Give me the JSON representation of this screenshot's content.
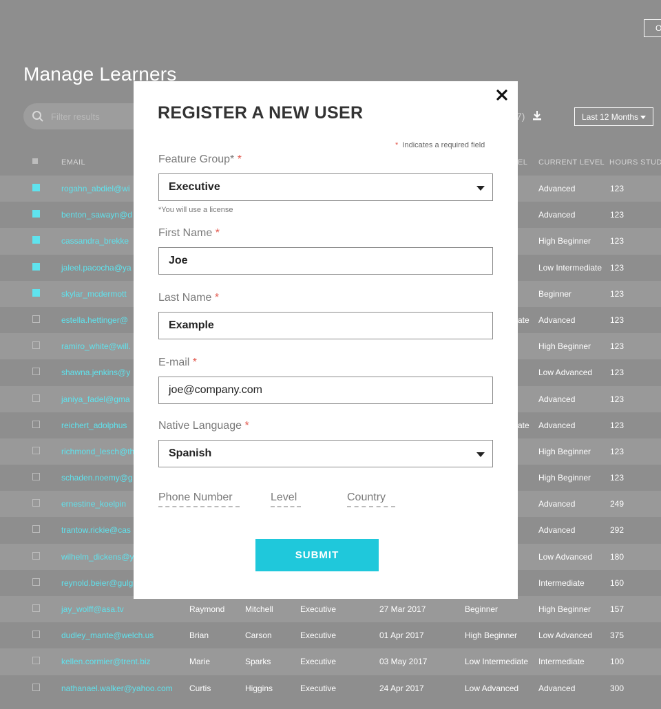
{
  "top_button": {
    "label": "O"
  },
  "page": {
    "title": "Manage Learners"
  },
  "filter": {
    "placeholder": "Filter results",
    "icon": "search-icon"
  },
  "toolbar": {
    "count_text": "7)",
    "download_icon": "download-icon",
    "range_label": "Last 12 Months"
  },
  "table": {
    "headers": {
      "email": "EMAIL",
      "prev_level": "EL",
      "current_level": "CURRENT LEVEL",
      "hours": "HOURS STUD"
    },
    "rows": [
      {
        "checked": true,
        "email": "rogahn_abdiel@wi",
        "first": "",
        "last": "",
        "group": "",
        "date": "",
        "start": "",
        "current": "Advanced",
        "hours": "123"
      },
      {
        "checked": true,
        "email": "benton_sawayn@d",
        "first": "",
        "last": "",
        "group": "",
        "date": "",
        "start": "",
        "current": "Advanced",
        "hours": "123"
      },
      {
        "checked": true,
        "email": "cassandra_brekke",
        "first": "",
        "last": "",
        "group": "",
        "date": "",
        "start": "",
        "current": "High Beginner",
        "hours": "123"
      },
      {
        "checked": true,
        "email": "jaleel.pacocha@ya",
        "first": "",
        "last": "",
        "group": "",
        "date": "",
        "start": "",
        "current": "Low Intermediate",
        "hours": "123"
      },
      {
        "checked": true,
        "email": "skylar_mcdermott",
        "first": "",
        "last": "",
        "group": "",
        "date": "",
        "start": "",
        "current": "Beginner",
        "hours": "123"
      },
      {
        "checked": false,
        "email": "estella.hettinger@",
        "first": "",
        "last": "",
        "group": "",
        "date": "",
        "start": "ate",
        "current": "Advanced",
        "hours": "123"
      },
      {
        "checked": false,
        "email": "ramiro_white@will.",
        "first": "",
        "last": "",
        "group": "",
        "date": "",
        "start": "",
        "current": "High Beginner",
        "hours": "123"
      },
      {
        "checked": false,
        "email": "shawna.jenkins@y",
        "first": "",
        "last": "",
        "group": "",
        "date": "",
        "start": "",
        "current": "Low Advanced",
        "hours": "123"
      },
      {
        "checked": false,
        "email": "janiya_fadel@gma",
        "first": "",
        "last": "",
        "group": "",
        "date": "",
        "start": "",
        "current": "Advanced",
        "hours": "123"
      },
      {
        "checked": false,
        "email": "reichert_adolphus",
        "first": "",
        "last": "",
        "group": "",
        "date": "",
        "start": "ate",
        "current": "Advanced",
        "hours": "123"
      },
      {
        "checked": false,
        "email": "richmond_lesch@th",
        "first": "",
        "last": "",
        "group": "",
        "date": "",
        "start": "",
        "current": "High Beginner",
        "hours": "123"
      },
      {
        "checked": false,
        "email": "schaden.noemy@g",
        "first": "",
        "last": "",
        "group": "",
        "date": "",
        "start": "",
        "current": "High Beginner",
        "hours": "123"
      },
      {
        "checked": false,
        "email": "ernestine_koelpin",
        "first": "",
        "last": "",
        "group": "",
        "date": "",
        "start": "",
        "current": "Advanced",
        "hours": "249"
      },
      {
        "checked": false,
        "email": "trantow.rickie@cas",
        "first": "",
        "last": "",
        "group": "",
        "date": "",
        "start": "",
        "current": "Advanced",
        "hours": "292"
      },
      {
        "checked": false,
        "email": "wilhelm_dickens@y",
        "first": "",
        "last": "",
        "group": "",
        "date": "",
        "start": "",
        "current": "Low Advanced",
        "hours": "180"
      },
      {
        "checked": false,
        "email": "reynold.beier@gulg",
        "first": "",
        "last": "",
        "group": "",
        "date": "",
        "start": "",
        "current": "Intermediate",
        "hours": "160"
      },
      {
        "checked": false,
        "email": "jay_wolff@asa.tv",
        "first": "Raymond",
        "last": "Mitchell",
        "group": "Executive",
        "date": "27 Mar 2017",
        "start": "Beginner",
        "current": "High Beginner",
        "hours": "157"
      },
      {
        "checked": false,
        "email": "dudley_mante@welch.us",
        "first": "Brian",
        "last": "Carson",
        "group": "Executive",
        "date": "01 Apr 2017",
        "start": "High Beginner",
        "current": "Low Advanced",
        "hours": "375"
      },
      {
        "checked": false,
        "email": "kellen.cormier@trent.biz",
        "first": "Marie",
        "last": "Sparks",
        "group": "Executive",
        "date": "03 May 2017",
        "start": "Low Intermediate",
        "current": "Intermediate",
        "hours": "100"
      },
      {
        "checked": false,
        "email": "nathanael.walker@yahoo.com",
        "first": "Curtis",
        "last": "Higgins",
        "group": "Executive",
        "date": "24 Apr 2017",
        "start": "Low Advanced",
        "current": "Advanced",
        "hours": "300"
      }
    ]
  },
  "modal": {
    "title": "REGISTER A NEW USER",
    "required_note": "Indicates a required field",
    "required_star": "*",
    "feature_group": {
      "label": "Feature Group*",
      "value": "Executive",
      "hint": "*You will use a license"
    },
    "first_name": {
      "label": "First Name",
      "value": "Joe"
    },
    "last_name": {
      "label": "Last Name",
      "value": "Example"
    },
    "email": {
      "label": "E-mail",
      "value": "joe@company.com"
    },
    "native_language": {
      "label": "Native Language",
      "value": "Spanish"
    },
    "phone_label": "Phone Number",
    "level_label": "Level",
    "country_label": "Country",
    "submit_label": "SUBMIT"
  },
  "colors": {
    "accent": "#1fc8db",
    "email_text": "#5fe3ee",
    "required": "#e2574c",
    "backdrop": "#8e8e8e"
  }
}
